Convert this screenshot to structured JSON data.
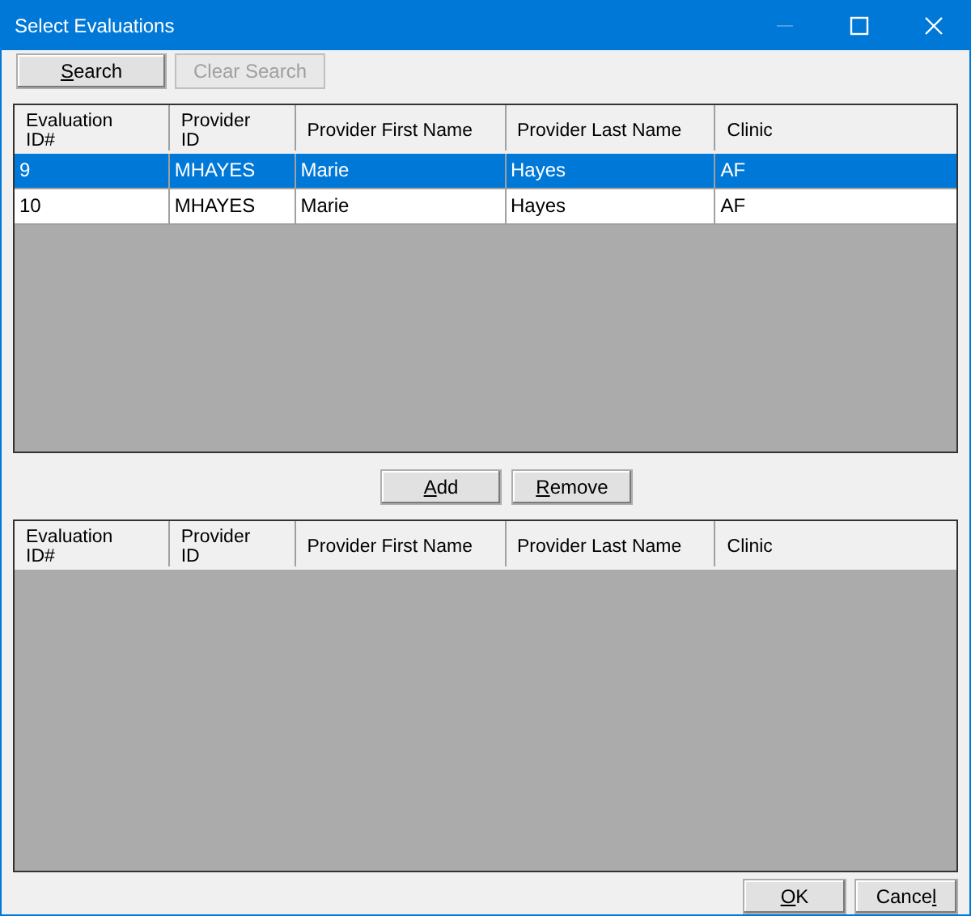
{
  "window": {
    "title": "Select Evaluations"
  },
  "search_buttons": [
    {
      "key": "S",
      "post": "earch",
      "disabled": false
    },
    {
      "pre": "Clear Search",
      "disabled": true
    }
  ],
  "available_table": {
    "columns": [
      "Evaluation\nID#",
      "Provider\nID",
      "Provider First Name",
      "Provider Last Name",
      "Clinic"
    ],
    "rows": [
      {
        "cells": [
          "9",
          "MHAYES",
          "Marie",
          "Hayes",
          "AF"
        ],
        "selected": true
      },
      {
        "cells": [
          "10",
          "MHAYES",
          "Marie",
          "Hayes",
          "AF"
        ],
        "selected": false
      }
    ]
  },
  "move_buttons": [
    {
      "key": "A",
      "post": "dd",
      "disabled": false
    },
    {
      "key": "R",
      "post": "emove",
      "disabled": false
    }
  ],
  "selected_table": {
    "columns": [
      "Evaluation\nID#",
      "Provider\nID",
      "Provider First Name",
      "Provider Last Name",
      "Clinic"
    ]
  },
  "dialog_buttons": [
    {
      "key": "O",
      "post": "K",
      "disabled": false
    },
    {
      "pre": "Cance",
      "key": "l",
      "disabled": false
    }
  ]
}
